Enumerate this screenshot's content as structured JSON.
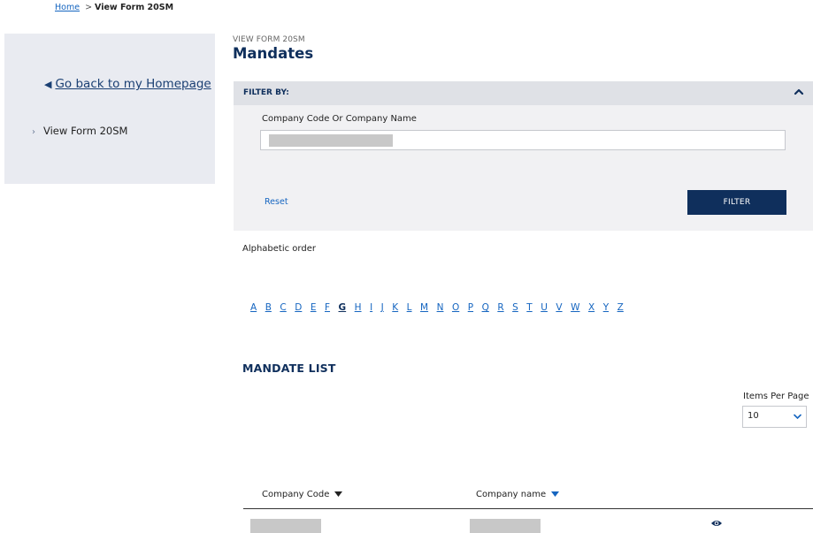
{
  "breadcrumb": {
    "home": "Home",
    "separator": ">",
    "current": "View Form 20SM"
  },
  "sidebar": {
    "back_label": "Go back to my Homepage",
    "items": [
      {
        "label": "View Form 20SM"
      }
    ]
  },
  "header": {
    "kicker": "VIEW FORM 20SM",
    "title": "Mandates"
  },
  "filter": {
    "heading": "FILTER BY:",
    "field_label": "Company Code Or Company Name",
    "reset_label": "Reset",
    "button_label": "FILTER"
  },
  "alphabet": {
    "label": "Alphabetic order",
    "letters": [
      "A",
      "B",
      "C",
      "D",
      "E",
      "F",
      "G",
      "H",
      "I",
      "J",
      "K",
      "L",
      "M",
      "N",
      "O",
      "P",
      "Q",
      "R",
      "S",
      "T",
      "U",
      "V",
      "W",
      "X",
      "Y",
      "Z"
    ],
    "active": "G"
  },
  "mandate_list": {
    "title": "MANDATE LIST",
    "items_per_page_label": "Items Per Page",
    "items_per_page_value": "10",
    "columns": {
      "code": "Company Code",
      "name": "Company name"
    }
  },
  "icons": {
    "collapse": "chevron-up-icon",
    "back": "triangle-left-icon",
    "nav": "chevron-right-icon",
    "select": "chevron-down-icon",
    "sort": "sort-down-icon",
    "view": "eye-icon"
  },
  "colors": {
    "primary": "#0f2f5c",
    "link": "#1565c0",
    "sidebar_bg": "#e9ebf1",
    "filter_bg": "#f1f1f3"
  }
}
